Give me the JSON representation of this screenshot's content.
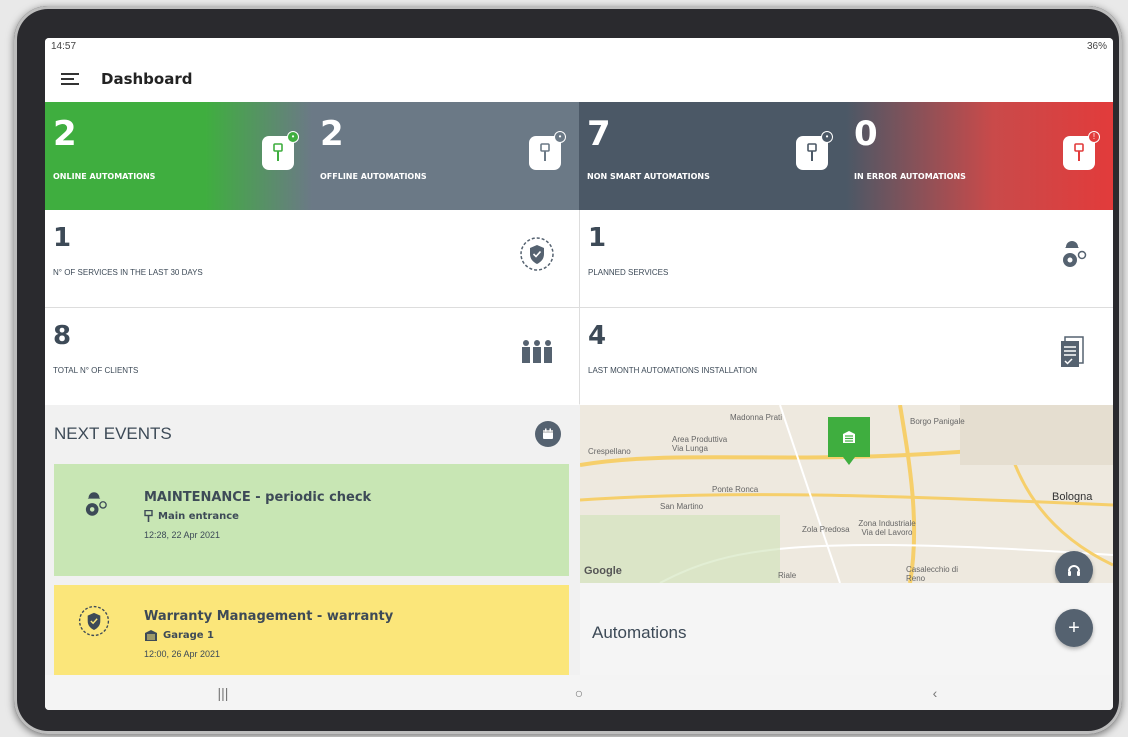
{
  "status": {
    "time": "14:57",
    "right": "36%"
  },
  "appbar": {
    "title": "Dashboard"
  },
  "tiles": [
    {
      "value": "2",
      "label": "ONLINE AUTOMATIONS",
      "color": "#3fae3f"
    },
    {
      "value": "2",
      "label": "OFFLINE AUTOMATIONS",
      "color": "#6b7986"
    },
    {
      "value": "7",
      "label": "NON SMART AUTOMATIONS",
      "color": "#4b5866"
    },
    {
      "value": "0",
      "label": "IN ERROR AUTOMATIONS",
      "color": "#e23b3b"
    }
  ],
  "stats": {
    "services": {
      "value": "1",
      "label": "N° OF SERVICES IN THE LAST 30 DAYS"
    },
    "planned": {
      "value": "1",
      "label": "PLANNED SERVICES"
    },
    "clients": {
      "value": "8",
      "label": "TOTAL N° OF CLIENTS"
    },
    "installations": {
      "value": "4",
      "label": "LAST MONTH AUTOMATIONS INSTALLATION"
    }
  },
  "events": {
    "title": "NEXT EVENTS",
    "items": [
      {
        "title": "MAINTENANCE - periodic check",
        "place": "Main entrance",
        "time": "12:28, 22 Apr 2021",
        "color": "#c8e6b4"
      },
      {
        "title": "Warranty Management - warranty",
        "place": "Garage 1",
        "time": "12:00, 26 Apr 2021",
        "color": "#fbe67a"
      }
    ]
  },
  "map": {
    "labels": [
      "Madonna Prati",
      "Borgo Panigale",
      "Area Produttiva Via Lunga",
      "Crespellano",
      "Ponte Ronca",
      "San Martino",
      "Zona Industriale Via del Lavoro",
      "Zola Predosa",
      "Casalecchio di Reno",
      "Riale",
      "Bologna"
    ],
    "attribution": "Google"
  },
  "automations": {
    "title": "Automations"
  }
}
